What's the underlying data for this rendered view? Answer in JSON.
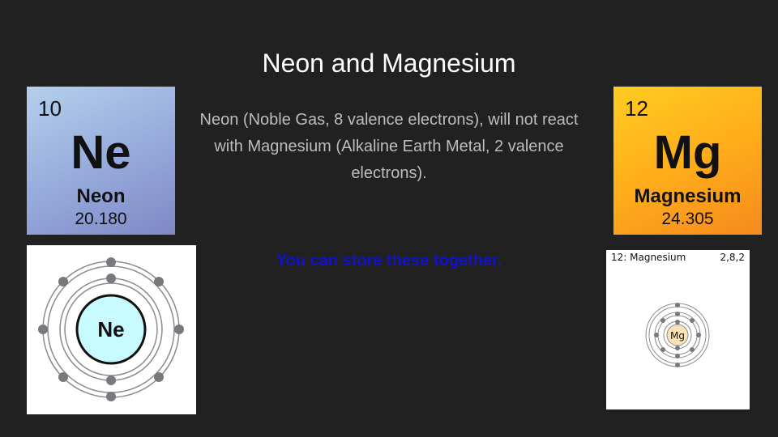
{
  "title": "Neon and Magnesium",
  "neon_tile": {
    "number": "10",
    "symbol": "Ne",
    "name": "Neon",
    "mass": "20.180"
  },
  "magnesium_tile": {
    "number": "12",
    "symbol": "Mg",
    "name": "Magnesium",
    "mass": "24.305"
  },
  "description": "Neon (Noble Gas, 8 valence electrons), will not react with Magnesium (Alkaline Earth Metal, 2 valence electrons).",
  "note": "You can store these together.",
  "neon_diagram": {
    "nucleus_label": "Ne"
  },
  "magnesium_diagram": {
    "header_left": "12: Magnesium",
    "header_right": "2,8,2",
    "nucleus_label": "Mg"
  },
  "colors": {
    "background": "#212121",
    "title": "#ffffff",
    "description": "#bdbdbd",
    "note": "#1212cc",
    "neon_nucleus": "#c8fbff",
    "magnesium_nucleus": "#fde2b4",
    "electron": "#77797d"
  }
}
